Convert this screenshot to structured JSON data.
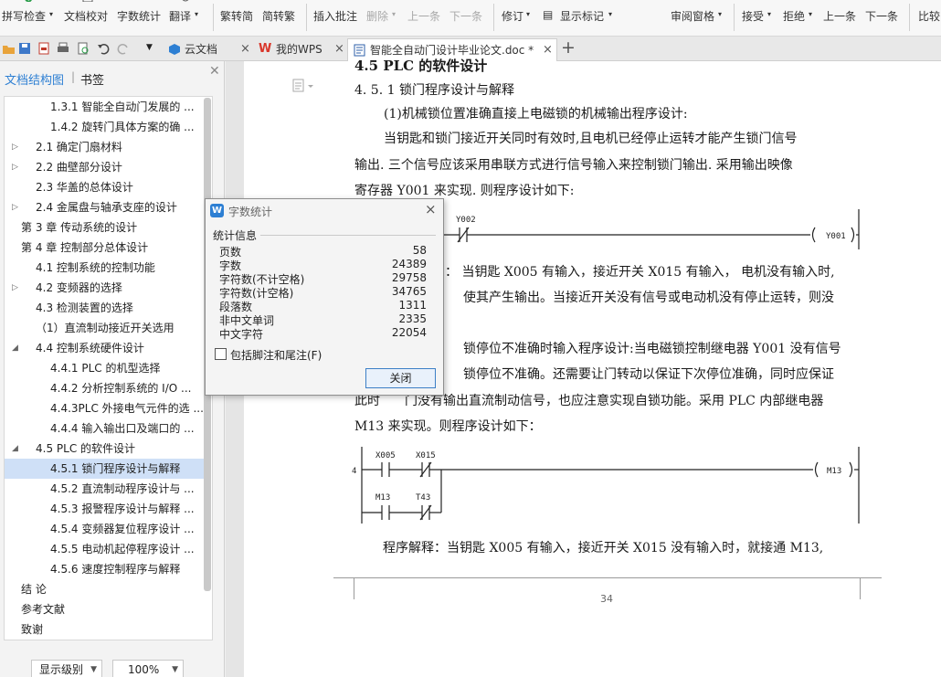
{
  "ribbon": {
    "spell_check": "拼写检查",
    "doc_proof": "文档校对",
    "word_count": "字数统计",
    "translate": "翻译",
    "trad_conv": "繁转简",
    "simp_conv": "简转繁",
    "insert_comment": "插入批注",
    "delete": "删除",
    "prev_item": "上一条",
    "next_item": "下一条",
    "revise": "修订",
    "show_marks": "显示标记",
    "review_pane": "审阅窗格",
    "accept": "接受",
    "reject": "拒绝",
    "prev": "上一条",
    "next": "下一条",
    "compare": "比较"
  },
  "tabs": {
    "cloud_doc": "云文档",
    "my_wps": "我的WPS",
    "doc_name": "智能全自动门设计毕业论文.doc *",
    "close_glyph": "×",
    "add_glyph": "+"
  },
  "left_panel": {
    "tab_outline": "文档结构图",
    "tab_bookmark": "书签",
    "outline": [
      {
        "label": "1.3.1 智能全自动门发展的 ...",
        "level": 3,
        "expand": "",
        "selected": false
      },
      {
        "label": "1.4.2 旋转门具体方案的确 ...",
        "level": 3,
        "expand": "",
        "selected": false
      },
      {
        "label": "2.1 确定门扇材料",
        "level": 2,
        "expand": "collapsed",
        "selected": false
      },
      {
        "label": "2.2  曲壁部分设计",
        "level": 2,
        "expand": "collapsed",
        "selected": false
      },
      {
        "label": "2.3 华盖的总体设计",
        "level": 2,
        "expand": "",
        "selected": false
      },
      {
        "label": "2.4 金属盘与轴承支座的设计",
        "level": 2,
        "expand": "collapsed",
        "selected": false
      },
      {
        "label": "第 3 章  传动系统的设计",
        "level": 1,
        "expand": "collapsed",
        "selected": false
      },
      {
        "label": "第 4 章  控制部分总体设计",
        "level": 1,
        "expand": "expanded",
        "selected": false
      },
      {
        "label": "4.1 控制系统的控制功能",
        "level": 2,
        "expand": "",
        "selected": false
      },
      {
        "label": "4.2  变频器的选择",
        "level": 2,
        "expand": "collapsed",
        "selected": false
      },
      {
        "label": "4.3 检测装置的选择",
        "level": 2,
        "expand": "",
        "selected": false
      },
      {
        "label": "（1）直流制动接近开关选用",
        "level": 2,
        "expand": "",
        "selected": false
      },
      {
        "label": "4.4 控制系统硬件设计",
        "level": 2,
        "expand": "expanded",
        "selected": false
      },
      {
        "label": "4.4.1 PLC 的机型选择",
        "level": 3,
        "expand": "",
        "selected": false
      },
      {
        "label": "4.4.2 分析控制系统的 I/O ...",
        "level": 3,
        "expand": "",
        "selected": false
      },
      {
        "label": "4.4.3PLC 外接电气元件的选 ...",
        "level": 3,
        "expand": "",
        "selected": false
      },
      {
        "label": "4.4.4  输入输出口及端口的 ...",
        "level": 3,
        "expand": "",
        "selected": false
      },
      {
        "label": "4.5 PLC 的软件设计",
        "level": 2,
        "expand": "expanded",
        "selected": false
      },
      {
        "label": "4.5.1 锁门程序设计与解释",
        "level": 3,
        "expand": "",
        "selected": true
      },
      {
        "label": "4.5.2 直流制动程序设计与 ...",
        "level": 3,
        "expand": "",
        "selected": false
      },
      {
        "label": "4.5.3 报警程序设计与解释 ...",
        "level": 3,
        "expand": "",
        "selected": false
      },
      {
        "label": "4.5.4 变频器复位程序设计 ...",
        "level": 3,
        "expand": "",
        "selected": false
      },
      {
        "label": "4.5.5 电动机起停程序设计 ...",
        "level": 3,
        "expand": "",
        "selected": false
      },
      {
        "label": "4.5.6 速度控制程序与解释",
        "level": 3,
        "expand": "",
        "selected": false
      },
      {
        "label": "结  论",
        "level": 1,
        "expand": "",
        "selected": false
      },
      {
        "label": "参考文献",
        "level": 1,
        "expand": "",
        "selected": false
      },
      {
        "label": "致谢",
        "level": 1,
        "expand": "",
        "selected": false
      }
    ],
    "display_level": "显示级别",
    "zoom": "100%"
  },
  "document": {
    "h_partial": "4.5  PLC 的软件设计",
    "h_sub": "4. 5. 1 锁门程序设计与解释",
    "p1": "(1)机械锁位置准确直接上电磁锁的机械输出程序设计:",
    "p2_l1": "当钥匙和锁门接近开关同时有效时,且电机已经停止运转才能产生锁门信号",
    "p2_l2": "输出. 三个信号应该采用串联方式进行信号输入来控制锁门输出. 采用输出映像",
    "p2_l3": "寄存器 Y001 来实现. 则程序设计如下:",
    "p3_l1": "：  当钥匙 X005 有输入，接近开关 X015 有输入，  电机没有输入时,",
    "p3_l2": "使其产生输出。当接近开关没有信号或电动机没有停止运转，则没",
    "p4_l1": "锁停位不准确时输入程序设计:当电磁锁控制继电器 Y001 没有信号",
    "p4_l2": "锁停位不准确。还需要让门转动以保证下次停位准确，同时应保证",
    "p4_l3a": "此时",
    "p4_l3b": "门没有输出直流制动信号，也应注意实现自锁功能。采用 PLC 内部继电器",
    "p4_l4": "M13 来实现。则程序设计如下：",
    "p5": "程序解释：当钥匙 X005 有输入，接近开关 X015 没有输入时，就接通 M13,",
    "page_no": "34",
    "ladder1": {
      "contact": "Y002",
      "coil": "Y001"
    },
    "ladder2": {
      "c1": "X005",
      "c2": "X015",
      "c3": "M13",
      "c4": "T43",
      "coil": "M13"
    }
  },
  "dialog": {
    "title": "字数统计",
    "group": "统计信息",
    "stats": [
      {
        "label": "页数",
        "value": "58"
      },
      {
        "label": "字数",
        "value": "24389"
      },
      {
        "label": "字符数(不计空格)",
        "value": "29758"
      },
      {
        "label": "字符数(计空格)",
        "value": "34765"
      },
      {
        "label": "段落数",
        "value": "1311"
      },
      {
        "label": "非中文单词",
        "value": "2335"
      },
      {
        "label": "中文字符",
        "value": "22054"
      }
    ],
    "include_notes": "包括脚注和尾注(F)",
    "close_btn": "关闭",
    "close_glyph": "×"
  },
  "colors": {
    "accent": "#2d7fd3",
    "selection": "#cfe0f7",
    "wps_red": "#d9372b"
  }
}
